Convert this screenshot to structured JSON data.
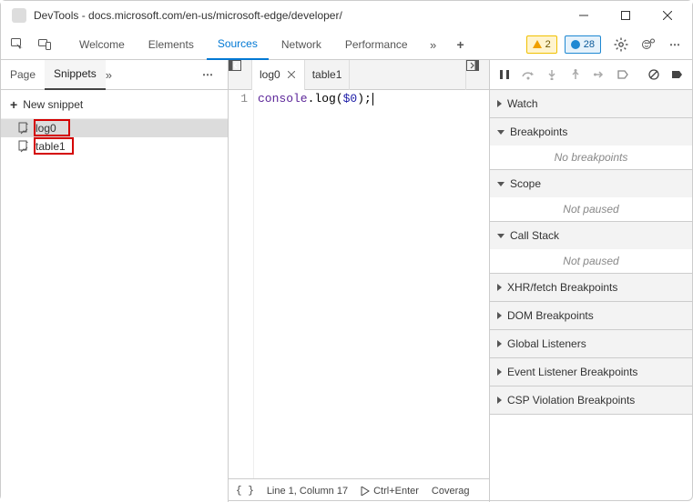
{
  "window": {
    "title": "DevTools - docs.microsoft.com/en-us/microsoft-edge/developer/"
  },
  "topbar": {
    "tabs": [
      "Welcome",
      "Elements",
      "Sources",
      "Network",
      "Performance"
    ],
    "active": "Sources",
    "warn_count": "2",
    "info_count": "28"
  },
  "navigator": {
    "tabs": [
      "Page",
      "Snippets"
    ],
    "active": "Snippets",
    "new_label": "New snippet",
    "items": [
      {
        "name": "log0",
        "selected": true
      },
      {
        "name": "table1",
        "selected": false
      }
    ]
  },
  "editor": {
    "tabs": [
      {
        "name": "log0",
        "active": true,
        "closeable": true
      },
      {
        "name": "table1",
        "active": false,
        "closeable": false
      }
    ],
    "line_number": "1",
    "code_obj": "console",
    "code_method": ".log(",
    "code_arg": "$0",
    "code_end": ");"
  },
  "status": {
    "position": "Line 1, Column 17",
    "run_hint": "Ctrl+Enter",
    "coverage": "Coverag"
  },
  "debugger": {
    "sections": [
      {
        "label": "Watch",
        "expanded": false
      },
      {
        "label": "Breakpoints",
        "expanded": true,
        "body": "No breakpoints"
      },
      {
        "label": "Scope",
        "expanded": true,
        "body": "Not paused"
      },
      {
        "label": "Call Stack",
        "expanded": true,
        "body": "Not paused"
      },
      {
        "label": "XHR/fetch Breakpoints",
        "expanded": false
      },
      {
        "label": "DOM Breakpoints",
        "expanded": false
      },
      {
        "label": "Global Listeners",
        "expanded": false
      },
      {
        "label": "Event Listener Breakpoints",
        "expanded": false
      },
      {
        "label": "CSP Violation Breakpoints",
        "expanded": false
      }
    ]
  }
}
